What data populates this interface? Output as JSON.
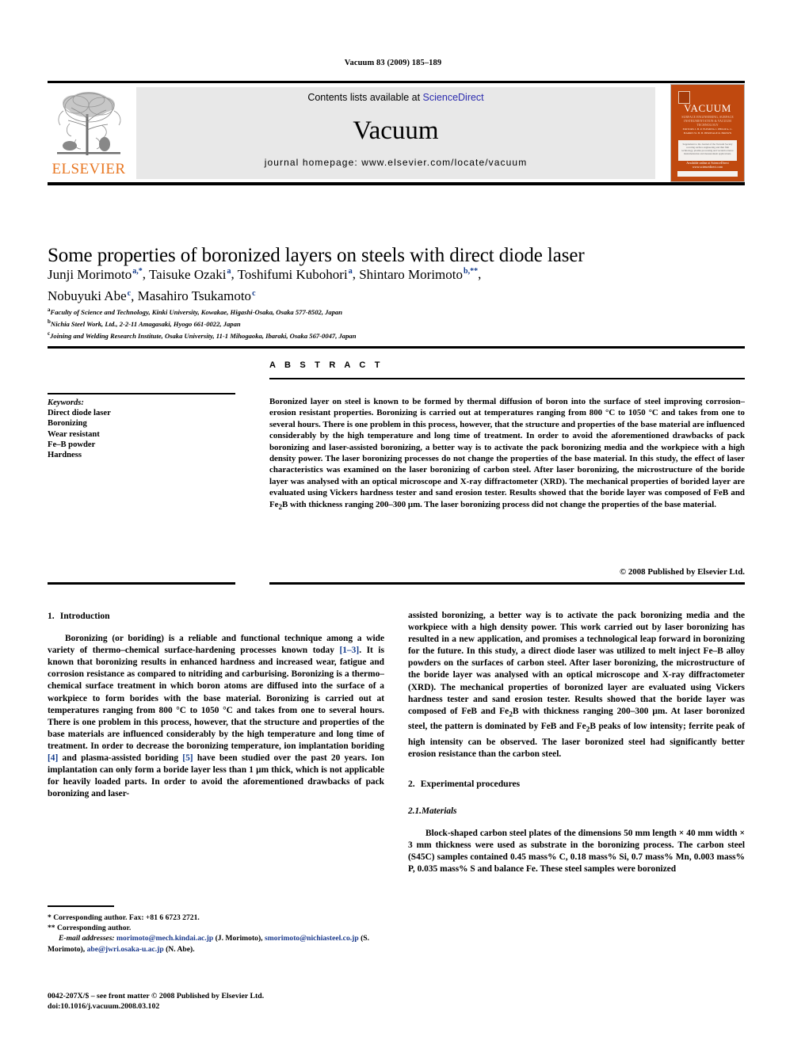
{
  "running_head": "Vacuum 83 (2009) 185–189",
  "masthead": {
    "contents_prefix": "Contents lists available at ",
    "sciencedirect": "ScienceDirect",
    "journal_name": "Vacuum",
    "homepage": "journal homepage: www.elsevier.com/locate/vacuum",
    "publisher_logo_text": "ELSEVIER",
    "link_color": "#2B2BAE",
    "cover": {
      "title": "VACUUM",
      "subtitle": "SURFACE ENGINEERING, SURFACE INSTRUMENTATION & VACUUM TECHNOLOGY",
      "editors": "EDITORS\nJ. H. P. FLEMING   J. PHILIP  A. C. HARRIS\nW. H. H. HERITAGE   R. BROWN",
      "blurb": "Supplement to the Journal of the Vacuum Society covering surface engineering and thin film technology, plasma processing and vacuum science instrumentation and measurement applications.",
      "footer": "Available online at\nScienceDirect\nwww.sciencedirect.com",
      "accent_color": "#C0490F"
    }
  },
  "article": {
    "title": "Some properties of boronized layers on steels with direct diode laser",
    "authors": [
      {
        "name": "Junji Morimoto",
        "marks": "a,*"
      },
      {
        "name": "Taisuke Ozaki",
        "marks": "a"
      },
      {
        "name": "Toshifumi Kubohori",
        "marks": "a"
      },
      {
        "name": "Shintaro Morimoto",
        "marks": "b,**"
      },
      {
        "name": "Nobuyuki Abe",
        "marks": "c"
      },
      {
        "name": "Masahiro Tsukamoto",
        "marks": "c"
      }
    ],
    "affiliations": [
      {
        "mark": "a",
        "text": "Faculty of Science and Technology, Kinki University, Kowakae, Higashi-Osaka, Osaka 577-8502, Japan"
      },
      {
        "mark": "b",
        "text": "Nichia Steel Work, Ltd., 2-2-11 Amagasaki, Hyogo 661-0022, Japan"
      },
      {
        "mark": "c",
        "text": "Joining and Welding Research Institute, Osaka University, 11-1 Mihogaoka, Ibaraki, Osaka 567-0047, Japan"
      }
    ]
  },
  "abstract_panel": {
    "heading": "A B S T R A C T",
    "keywords_title": "Keywords:",
    "keywords": [
      "Direct diode laser",
      "Boronizing",
      "Wear resistant",
      "Fe–B powder",
      "Hardness"
    ],
    "text": "Boronized layer on steel is known to be formed by thermal diffusion of boron into the surface of steel improving corrosion–erosion resistant properties. Boronizing is carried out at temperatures ranging from 800 °C to 1050 °C and takes from one to several hours. There is one problem in this process, however, that the structure and properties of the base material are influenced considerably by the high temperature and long time of treatment. In order to avoid the aforementioned drawbacks of pack boronizing and laser-assisted boronizing, a better way is to activate the pack boronizing media and the workpiece with a high density power. The laser boronizing processes do not change the properties of the base material. In this study, the effect of laser characteristics was examined on the laser boronizing of carbon steel. After laser boronizing, the microstructure of the boride layer was analysed with an optical microscope and X-ray diffractometer (XRD). The mechanical properties of borided layer are evaluated using Vickers hardness tester and sand erosion tester. Results showed that the boride layer was composed of FeB and Fe2B with thickness ranging 200–300 μm. The laser boronizing process did not change the properties of the base material.",
    "copyright": "© 2008 Published by Elsevier Ltd."
  },
  "body": {
    "section1": {
      "number": "1.",
      "title": "Introduction",
      "para1_a": "Boronizing (or boriding) is a reliable and functional technique among a wide variety of thermo–chemical surface-hardening processes known today ",
      "ref13": "[1–3]",
      "para1_b": ". It is known that boronizing results in enhanced hardness and increased wear, fatigue and corrosion resistance as compared to nitriding and carburising. Boronizing is a thermo–chemical surface treatment in which boron atoms are diffused into the surface of a workpiece to form borides with the base material. Boronizing is carried out at temperatures ranging from 800 °C to 1050 °C and takes from one to several hours. There is one problem in this process, however, that the structure and properties of the base materials are influenced considerably by the high temperature and long time of treatment. In order to decrease the boronizing temperature, ion implantation boriding ",
      "ref4": "[4]",
      "para1_c": " and plasma-assisted boriding ",
      "ref5": "[5]",
      "para1_d": " have been studied over the past 20 years. Ion implantation can only form a boride layer less than 1 μm thick, which is not applicable for heavily loaded parts. In order to avoid the aforementioned drawbacks of pack boronizing and laser-"
    },
    "right_continuation": "assisted boronizing, a better way is to activate the pack boronizing media and the workpiece with a high density power. This work carried out by laser boronizing has resulted in a new application, and promises a technological leap forward in boronizing for the future. In this study, a direct diode laser was utilized to melt inject Fe–B alloy powders on the surfaces of carbon steel. After laser boronizing, the microstructure of the boride layer was analysed with an optical microscope and X-ray diffractometer (XRD). The mechanical properties of boronized layer are evaluated using Vickers hardness tester and sand erosion tester. Results showed that the boride layer was composed of FeB and Fe2B with thickness ranging 200–300 μm. At laser boronized steel, the pattern is dominated by FeB and Fe2B peaks of low intensity; ferrite peak of high intensity can be observed. The laser boronized steel had significantly better erosion resistance than the carbon steel.",
    "section2": {
      "number": "2.",
      "title": "Experimental procedures"
    },
    "subsection21": {
      "number": "2.1.",
      "title": "Materials"
    },
    "materials_para": "Block-shaped carbon steel plates of the dimensions 50 mm length × 40 mm width × 3 mm thickness were used as substrate in the boronizing process. The carbon steel (S45C) samples contained 0.45 mass% C, 0.18 mass% Si, 0.7 mass% Mn, 0.003 mass% P, 0.035 mass% S and balance Fe. These steel samples were boronized"
  },
  "footnotes": {
    "fn1": "* Corresponding author. Fax: +81 6 6723 2721.",
    "fn2": "** Corresponding author.",
    "email_label": "E-mail addresses:",
    "email1": "morimoto@mech.kindai.ac.jp",
    "email1_owner": " (J. Morimoto), ",
    "email2": "smorimoto@nichiasteel.co.jp",
    "email2_owner": " (S. Morimoto), ",
    "email3": "abe@jwri.osaka-u.ac.jp",
    "email3_owner": " (N. Abe)."
  },
  "imprint": {
    "line1": "0042-207X/$ – see front matter © 2008 Published by Elsevier Ltd.",
    "line2": "doi:10.1016/j.vacuum.2008.03.102"
  }
}
